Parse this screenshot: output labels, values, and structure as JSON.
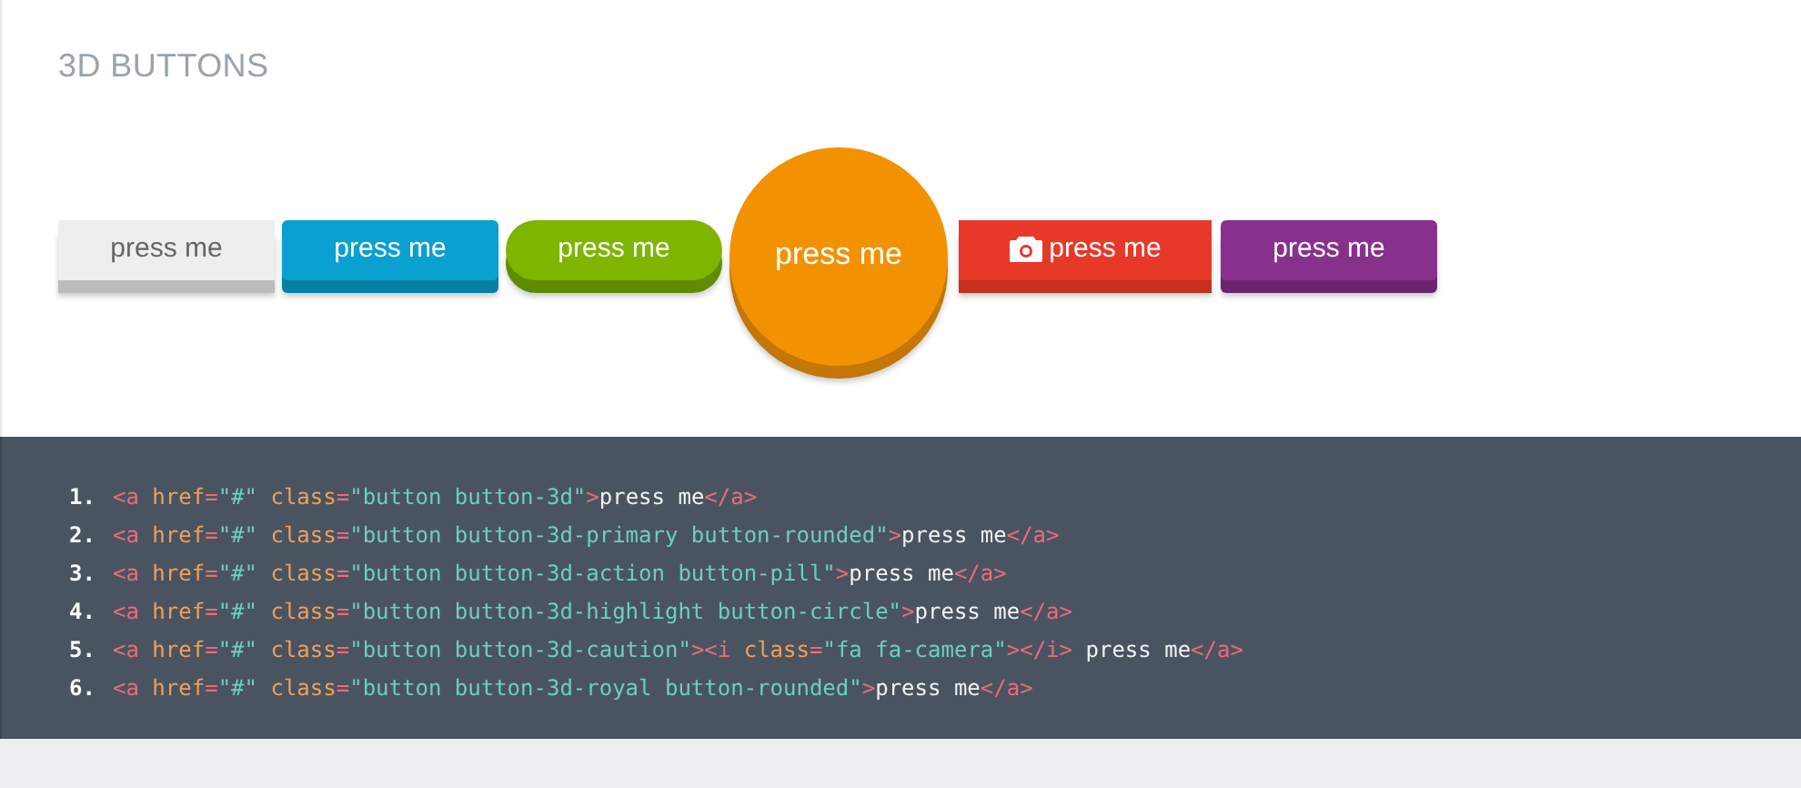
{
  "heading": "3D BUTTONS",
  "buttons": [
    {
      "label": "press me",
      "kind": "plain"
    },
    {
      "label": "press me",
      "kind": "primary"
    },
    {
      "label": "press me",
      "kind": "action"
    },
    {
      "label": "press me",
      "kind": "highlight"
    },
    {
      "label": "press me",
      "kind": "caution"
    },
    {
      "label": "press me",
      "kind": "royal"
    }
  ],
  "code_lines": [
    {
      "number": "1.",
      "tokens": [
        {
          "kind": "tag",
          "text": "<a"
        },
        {
          "kind": "attr",
          "text": " href"
        },
        {
          "kind": "tag",
          "text": "="
        },
        {
          "kind": "string",
          "text": "\"#\""
        },
        {
          "kind": "attr",
          "text": " class"
        },
        {
          "kind": "tag",
          "text": "="
        },
        {
          "kind": "string",
          "text": "\"button button-3d\""
        },
        {
          "kind": "tag",
          "text": ">"
        },
        {
          "kind": "text",
          "text": "press me"
        },
        {
          "kind": "tag",
          "text": "</a>"
        }
      ]
    },
    {
      "number": "2.",
      "tokens": [
        {
          "kind": "tag",
          "text": "<a"
        },
        {
          "kind": "attr",
          "text": " href"
        },
        {
          "kind": "tag",
          "text": "="
        },
        {
          "kind": "string",
          "text": "\"#\""
        },
        {
          "kind": "attr",
          "text": " class"
        },
        {
          "kind": "tag",
          "text": "="
        },
        {
          "kind": "string",
          "text": "\"button button-3d-primary button-rounded\""
        },
        {
          "kind": "tag",
          "text": ">"
        },
        {
          "kind": "text",
          "text": "press me"
        },
        {
          "kind": "tag",
          "text": "</a>"
        }
      ]
    },
    {
      "number": "3.",
      "tokens": [
        {
          "kind": "tag",
          "text": "<a"
        },
        {
          "kind": "attr",
          "text": " href"
        },
        {
          "kind": "tag",
          "text": "="
        },
        {
          "kind": "string",
          "text": "\"#\""
        },
        {
          "kind": "attr",
          "text": " class"
        },
        {
          "kind": "tag",
          "text": "="
        },
        {
          "kind": "string",
          "text": "\"button button-3d-action button-pill\""
        },
        {
          "kind": "tag",
          "text": ">"
        },
        {
          "kind": "text",
          "text": "press me"
        },
        {
          "kind": "tag",
          "text": "</a>"
        }
      ]
    },
    {
      "number": "4.",
      "tokens": [
        {
          "kind": "tag",
          "text": "<a"
        },
        {
          "kind": "attr",
          "text": " href"
        },
        {
          "kind": "tag",
          "text": "="
        },
        {
          "kind": "string",
          "text": "\"#\""
        },
        {
          "kind": "attr",
          "text": " class"
        },
        {
          "kind": "tag",
          "text": "="
        },
        {
          "kind": "string",
          "text": "\"button button-3d-highlight button-circle\""
        },
        {
          "kind": "tag",
          "text": ">"
        },
        {
          "kind": "text",
          "text": "press me"
        },
        {
          "kind": "tag",
          "text": "</a>"
        }
      ]
    },
    {
      "number": "5.",
      "tokens": [
        {
          "kind": "tag",
          "text": "<a"
        },
        {
          "kind": "attr",
          "text": " href"
        },
        {
          "kind": "tag",
          "text": "="
        },
        {
          "kind": "string",
          "text": "\"#\""
        },
        {
          "kind": "attr",
          "text": " class"
        },
        {
          "kind": "tag",
          "text": "="
        },
        {
          "kind": "string",
          "text": "\"button button-3d-caution\""
        },
        {
          "kind": "tag",
          "text": ">"
        },
        {
          "kind": "tag",
          "text": "<i"
        },
        {
          "kind": "attr",
          "text": " class"
        },
        {
          "kind": "tag",
          "text": "="
        },
        {
          "kind": "string",
          "text": "\"fa fa-camera\""
        },
        {
          "kind": "tag",
          "text": ">"
        },
        {
          "kind": "tag",
          "text": "</i>"
        },
        {
          "kind": "text",
          "text": " press me"
        },
        {
          "kind": "tag",
          "text": "</a>"
        }
      ]
    },
    {
      "number": "6.",
      "tokens": [
        {
          "kind": "tag",
          "text": "<a"
        },
        {
          "kind": "attr",
          "text": " href"
        },
        {
          "kind": "tag",
          "text": "="
        },
        {
          "kind": "string",
          "text": "\"#\""
        },
        {
          "kind": "attr",
          "text": " class"
        },
        {
          "kind": "tag",
          "text": "="
        },
        {
          "kind": "string",
          "text": "\"button button-3d-royal button-rounded\""
        },
        {
          "kind": "tag",
          "text": ">"
        },
        {
          "kind": "text",
          "text": "press me"
        },
        {
          "kind": "tag",
          "text": "</a>"
        }
      ]
    }
  ]
}
